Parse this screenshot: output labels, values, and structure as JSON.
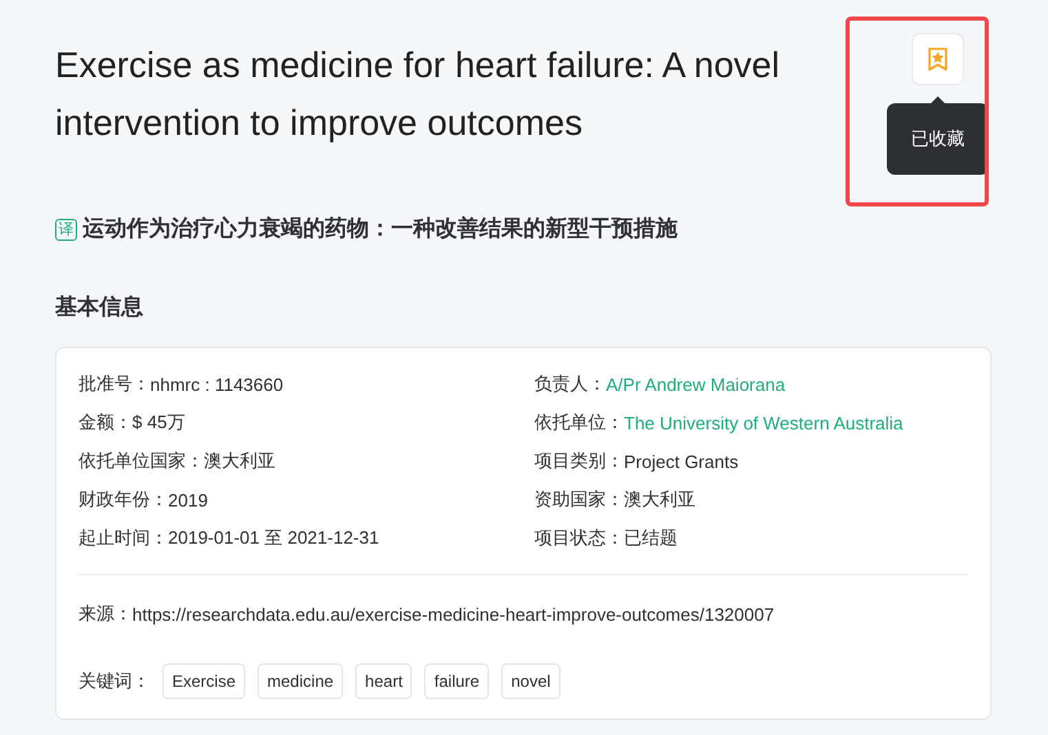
{
  "title": "Exercise as medicine for heart failure: A novel intervention to improve outcomes",
  "bookmark": {
    "bookmarked": true,
    "tooltip": "已收藏",
    "highlighted": true
  },
  "translation": {
    "badge": "译",
    "text": "运动作为治疗心力衰竭的药物：一种改善结果的新型干预措施"
  },
  "section_title": "基本信息",
  "info": [
    {
      "label": "批准号：",
      "value": "nhmrc : 1143660",
      "kind": "text"
    },
    {
      "label": "负责人：",
      "value": "A/Pr Andrew Maiorana",
      "kind": "link"
    },
    {
      "label": "金额：",
      "value": "$ 45万",
      "kind": "text"
    },
    {
      "label": "依托单位：",
      "value": "The University of Western Australia",
      "kind": "link"
    },
    {
      "label": "依托单位国家：",
      "value": "澳大利亚",
      "kind": "text"
    },
    {
      "label": "项目类别：",
      "value": "Project Grants",
      "kind": "text"
    },
    {
      "label": "财政年份：",
      "value": "2019",
      "kind": "text"
    },
    {
      "label": "资助国家：",
      "value": "澳大利亚",
      "kind": "text"
    },
    {
      "label": "起止时间：",
      "value": "2019-01-01 至 2021-12-31",
      "kind": "text"
    },
    {
      "label": "项目状态：",
      "value": "已结题",
      "kind": "text"
    }
  ],
  "source": {
    "label": "来源：",
    "value": "https://researchdata.edu.au/exercise-medicine-heart-improve-outcomes/1320007"
  },
  "keywords": {
    "label": "关键词：",
    "tags": [
      "Exercise",
      "medicine",
      "heart",
      "failure",
      "novel"
    ]
  }
}
